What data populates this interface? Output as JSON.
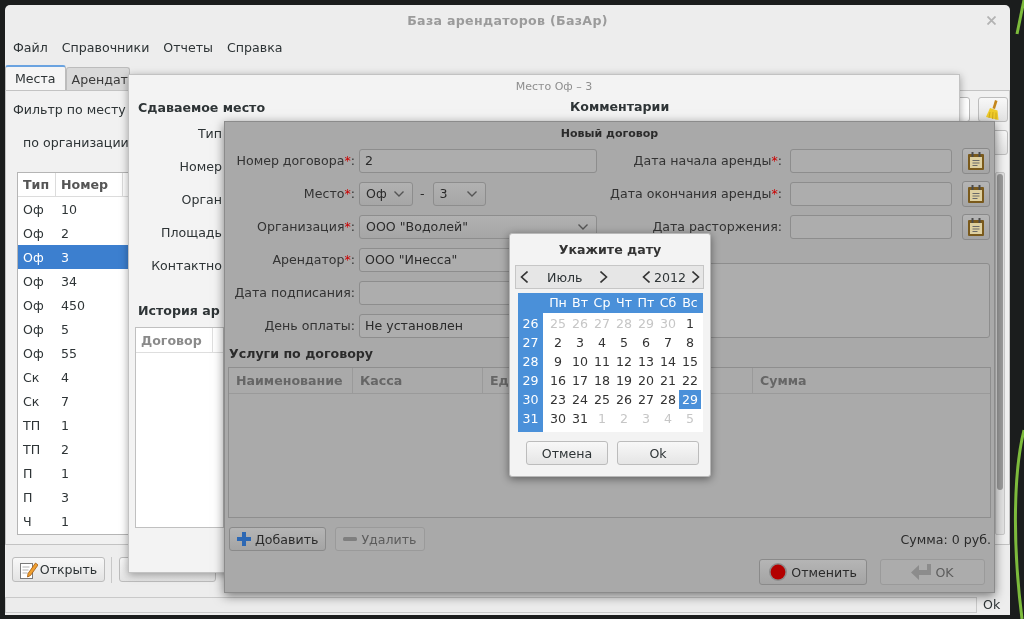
{
  "main_window": {
    "title": "База арендаторов (БазАр)",
    "menu": [
      "Файл",
      "Справочники",
      "Отчеты",
      "Справка"
    ],
    "tabs": [
      {
        "label": "Места",
        "selected": true
      },
      {
        "label": "Арендат",
        "selected": false
      }
    ],
    "filters": [
      "Фильтр по месту",
      "по организации"
    ],
    "table": {
      "columns": [
        "Тип",
        "Номер"
      ],
      "rows": [
        {
          "type": "Оф",
          "number": "10",
          "selected": false
        },
        {
          "type": "Оф",
          "number": "2",
          "selected": false
        },
        {
          "type": "Оф",
          "number": "3",
          "selected": true
        },
        {
          "type": "Оф",
          "number": "34",
          "selected": false
        },
        {
          "type": "Оф",
          "number": "450",
          "selected": false
        },
        {
          "type": "Оф",
          "number": "5",
          "selected": false
        },
        {
          "type": "Оф",
          "number": "55",
          "selected": false
        },
        {
          "type": "Ск",
          "number": "4",
          "selected": false
        },
        {
          "type": "Ск",
          "number": "7",
          "selected": false
        },
        {
          "type": "ТП",
          "number": "1",
          "selected": false
        },
        {
          "type": "ТП",
          "number": "2",
          "selected": false
        },
        {
          "type": "П",
          "number": "1",
          "selected": false
        },
        {
          "type": "П",
          "number": "3",
          "selected": false
        },
        {
          "type": "Ч",
          "number": "1",
          "selected": false
        }
      ]
    },
    "buttons": [
      "Открыть"
    ],
    "status": "Ok"
  },
  "place_dialog": {
    "title": "Место Оф – 3",
    "section": "Сдаваемое место",
    "labels": [
      "Тип",
      "Номер",
      "Орган",
      "Площадь",
      "Контактно"
    ],
    "history_heading": "История ар",
    "history_columns": [
      "Договор"
    ],
    "comments_heading": "Комментарии"
  },
  "contract_dialog": {
    "title": "Новый договор",
    "left_fields": [
      {
        "kind": "entry",
        "label": "Номер договора",
        "asterisk": "*",
        "colon": ":",
        "value": "2"
      },
      {
        "kind": "place",
        "label": "Место",
        "asterisk": "*",
        "colon": ":",
        "type": "Оф",
        "separator": "-",
        "number": "3"
      },
      {
        "kind": "combo",
        "label": "Организация",
        "asterisk": "*",
        "colon": ":",
        "value": "ООО \"Водолей\""
      },
      {
        "kind": "entry",
        "label": "Арендатор",
        "asterisk": "*",
        "colon": ":",
        "value": "ООО \"Инесса\""
      },
      {
        "kind": "entry",
        "label": "Дата подписания",
        "colon": ":"
      },
      {
        "kind": "entry",
        "label": "День оплаты",
        "colon": ":",
        "value": "Не установлен"
      }
    ],
    "date_fields": [
      {
        "label": "Дата начала аренды",
        "asterisk": "*",
        "colon": ":"
      },
      {
        "label": "Дата окончания аренды",
        "asterisk": "*",
        "colon": ":"
      },
      {
        "label": "Дата расторжения",
        "colon": ":"
      }
    ],
    "services_heading": "Услуги по договору",
    "services_columns": [
      "Наименование",
      "Касса",
      "Ед",
      "Сумма"
    ],
    "actions": [
      {
        "kind": "add",
        "label": "Добавить",
        "disabled": false
      },
      {
        "kind": "remove",
        "label": "Удалить",
        "disabled": true
      }
    ],
    "total": "Сумма: 0 руб.",
    "footer_buttons": [
      {
        "kind": "cancel",
        "label": "Отменить",
        "disabled": false
      },
      {
        "kind": "ok",
        "label": "OK",
        "disabled": true
      }
    ]
  },
  "date_picker": {
    "title": "Укажите дату",
    "month": "Июль",
    "year": "2012",
    "weekdays": [
      "Пн",
      "Вт",
      "Ср",
      "Чт",
      "Пт",
      "Сб",
      "Вс"
    ],
    "weeks": [
      {
        "number": "26",
        "days": [
          {
            "day": "25",
            "outside_month": true,
            "selected": false
          },
          {
            "day": "26",
            "outside_month": true,
            "selected": false
          },
          {
            "day": "27",
            "outside_month": true,
            "selected": false
          },
          {
            "day": "28",
            "outside_month": true,
            "selected": false
          },
          {
            "day": "29",
            "outside_month": true,
            "selected": false
          },
          {
            "day": "30",
            "outside_month": true,
            "selected": false
          },
          {
            "day": "1",
            "outside_month": false,
            "selected": false
          }
        ]
      },
      {
        "number": "27",
        "days": [
          {
            "day": "2",
            "outside_month": false,
            "selected": false
          },
          {
            "day": "3",
            "outside_month": false,
            "selected": false
          },
          {
            "day": "4",
            "outside_month": false,
            "selected": false
          },
          {
            "day": "5",
            "outside_month": false,
            "selected": false
          },
          {
            "day": "6",
            "outside_month": false,
            "selected": false
          },
          {
            "day": "7",
            "outside_month": false,
            "selected": false
          },
          {
            "day": "8",
            "outside_month": false,
            "selected": false
          }
        ]
      },
      {
        "number": "28",
        "days": [
          {
            "day": "9",
            "outside_month": false,
            "selected": false
          },
          {
            "day": "10",
            "outside_month": false,
            "selected": false
          },
          {
            "day": "11",
            "outside_month": false,
            "selected": false
          },
          {
            "day": "12",
            "outside_month": false,
            "selected": false
          },
          {
            "day": "13",
            "outside_month": false,
            "selected": false
          },
          {
            "day": "14",
            "outside_month": false,
            "selected": false
          },
          {
            "day": "15",
            "outside_month": false,
            "selected": false
          }
        ]
      },
      {
        "number": "29",
        "days": [
          {
            "day": "16",
            "outside_month": false,
            "selected": false
          },
          {
            "day": "17",
            "outside_month": false,
            "selected": false
          },
          {
            "day": "18",
            "outside_month": false,
            "selected": false
          },
          {
            "day": "19",
            "outside_month": false,
            "selected": false
          },
          {
            "day": "20",
            "outside_month": false,
            "selected": false
          },
          {
            "day": "21",
            "outside_month": false,
            "selected": false
          },
          {
            "day": "22",
            "outside_month": false,
            "selected": false
          }
        ]
      },
      {
        "number": "30",
        "days": [
          {
            "day": "23",
            "outside_month": false,
            "selected": false
          },
          {
            "day": "24",
            "outside_month": false,
            "selected": false
          },
          {
            "day": "25",
            "outside_month": false,
            "selected": false
          },
          {
            "day": "26",
            "outside_month": false,
            "selected": false
          },
          {
            "day": "27",
            "outside_month": false,
            "selected": false
          },
          {
            "day": "28",
            "outside_month": false,
            "selected": false
          },
          {
            "day": "29",
            "outside_month": false,
            "selected": true
          }
        ]
      },
      {
        "number": "31",
        "days": [
          {
            "day": "30",
            "outside_month": false,
            "selected": false
          },
          {
            "day": "31",
            "outside_month": false,
            "selected": false
          },
          {
            "day": "1",
            "outside_month": true,
            "selected": false
          },
          {
            "day": "2",
            "outside_month": true,
            "selected": false
          },
          {
            "day": "3",
            "outside_month": true,
            "selected": false
          },
          {
            "day": "4",
            "outside_month": true,
            "selected": false
          },
          {
            "day": "5",
            "outside_month": true,
            "selected": false
          }
        ]
      }
    ],
    "buttons": [
      "Отмена",
      "Ok"
    ]
  }
}
